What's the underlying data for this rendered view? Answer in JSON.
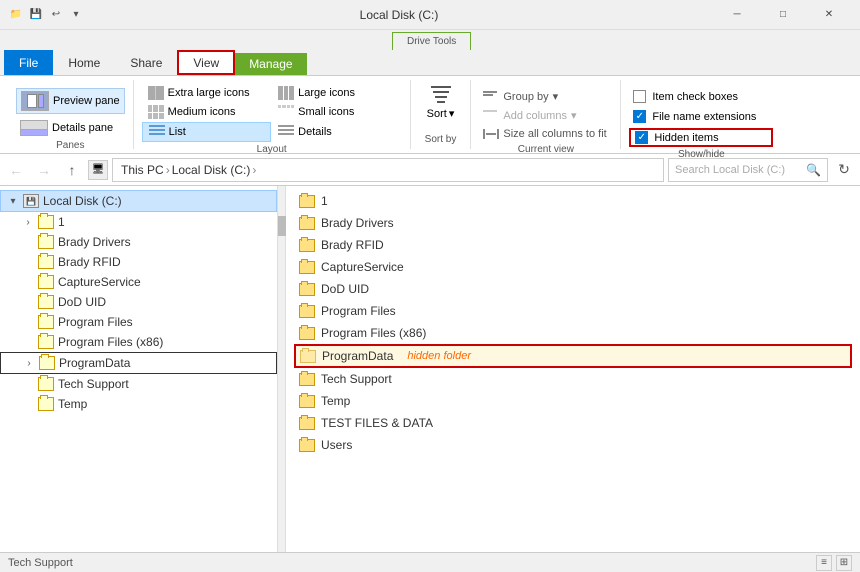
{
  "titleBar": {
    "title": "Local Disk (C:)",
    "windowControls": [
      "─",
      "□",
      "✕"
    ]
  },
  "tabs": {
    "file": "File",
    "home": "Home",
    "share": "Share",
    "view": "View",
    "manage": "Manage",
    "driveTools": "Drive Tools"
  },
  "ribbon": {
    "panes": {
      "label": "Panes",
      "previewPane": "Preview pane",
      "detailsPane": "Details pane"
    },
    "layout": {
      "label": "Layout",
      "extraLargeIcons": "Extra large icons",
      "largeIcons": "Large icons",
      "mediumIcons": "Medium icons",
      "smallIcons": "Small icons",
      "list": "List",
      "details": "Details"
    },
    "sort": {
      "label": "Sort by",
      "title": "Sort"
    },
    "currentView": {
      "label": "Current view",
      "groupBy": "Group by",
      "addColumns": "Add columns",
      "sizeAllColumns": "Size all columns to fit"
    },
    "showHide": {
      "label": "Show/hide",
      "itemCheckBoxes": "Item check boxes",
      "fileNameExtensions": "File name extensions",
      "hiddenItems": "Hidden items"
    }
  },
  "addressBar": {
    "path": "This PC › Local Disk (C:) ›",
    "searchPlaceholder": "Search Local Disk (C:)"
  },
  "tree": {
    "root": "Local Disk (C:)",
    "items": [
      {
        "name": "1",
        "indent": 1
      },
      {
        "name": "Brady Drivers",
        "indent": 1
      },
      {
        "name": "Brady RFID",
        "indent": 1
      },
      {
        "name": "CaptureService",
        "indent": 1
      },
      {
        "name": "DoD UID",
        "indent": 1
      },
      {
        "name": "Program Files",
        "indent": 1
      },
      {
        "name": "Program Files (x86)",
        "indent": 1
      },
      {
        "name": "ProgramData",
        "indent": 1,
        "bordered": true
      },
      {
        "name": "Tech Support",
        "indent": 1
      },
      {
        "name": "Temp",
        "indent": 1
      }
    ]
  },
  "files": [
    {
      "name": "1"
    },
    {
      "name": "Brady Drivers"
    },
    {
      "name": "Brady RFID"
    },
    {
      "name": "CaptureService"
    },
    {
      "name": "DoD UID"
    },
    {
      "name": "Program Files"
    },
    {
      "name": "Program Files (x86)"
    },
    {
      "name": "ProgramData",
      "highlighted": true,
      "hiddenLabel": "hidden folder"
    },
    {
      "name": "Tech Support"
    },
    {
      "name": "Temp"
    },
    {
      "name": "TEST FILES & DATA"
    },
    {
      "name": "Users"
    }
  ],
  "statusBar": {
    "text": "Tech Support"
  }
}
